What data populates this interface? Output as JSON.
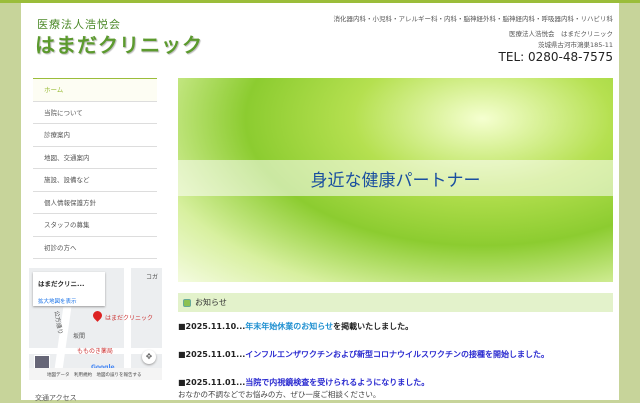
{
  "header": {
    "corp_name": "医療法人浩悦会",
    "clinic_name": "はまだクリニック",
    "departments": "消化器内科・小児科・アレルギー科・内科・脳神経外科・脳神経内科・呼吸器内科・リハビリ科",
    "corp_full": "医療法人浩悦会　はまだクリニック",
    "address": "茨城県古河市鴻巣185-11",
    "tel": "TEL: 0280-48-7575"
  },
  "nav": [
    {
      "label": "ホーム"
    },
    {
      "label": "当院について"
    },
    {
      "label": "診療案内"
    },
    {
      "label": "地図、交通案内"
    },
    {
      "label": "施設、設備など"
    },
    {
      "label": "個人情報保護方針"
    },
    {
      "label": "スタッフの募集"
    },
    {
      "label": "初診の方へ"
    }
  ],
  "map": {
    "title": "はまだクリニ...",
    "link": "拡大地図を表示",
    "pin_label": "はまだクリニック",
    "place1": "坂間",
    "place2": "もものき薬局",
    "road": "公方通り",
    "corner": "コガ",
    "google": "Google",
    "footer": [
      "地図データ",
      "利用規約",
      "地図の誤りを報告する"
    ]
  },
  "access_heading": "交通アクセス",
  "hero": {
    "title": "身近な健康パートナー"
  },
  "news": {
    "heading": "お知らせ",
    "items": [
      {
        "date": "■2025.11.10...",
        "link": "年末年始休業のお知らせ",
        "suffix": "を掲載いたしました。"
      },
      {
        "date": "■2025.11.01...",
        "link": "インフルエンザワクチンおよび新型コロナウイルスワクチンの接種を開始しました。",
        "suffix": ""
      },
      {
        "date": "■2025.11.01...",
        "link": "当院で内視鏡検査を受けられるようになりました。",
        "suffix": ""
      }
    ],
    "note": "おなかの不調などでお悩みの方、ぜひ一度ご相談ください。"
  },
  "colors": {
    "accent": "#9bbd3a",
    "link1": "#1e8fd0",
    "link2": "#2a2ad0"
  }
}
